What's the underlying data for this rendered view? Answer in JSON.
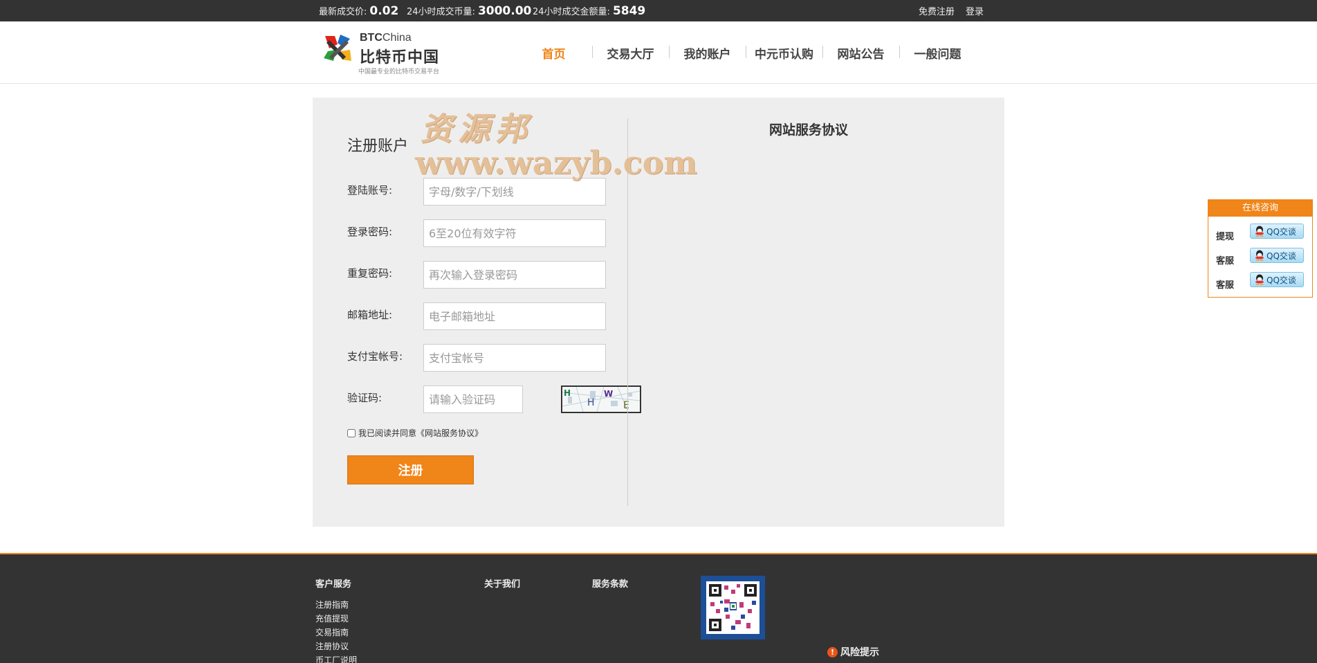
{
  "topbar": {
    "last_price_label": "最新成交价:",
    "last_price_value": "0.02",
    "volume_label": "24小时成交币量:",
    "volume_value": "3000.00",
    "amount_label": "24小时成交金额量:",
    "amount_value": "5849",
    "register_link": "免费注册",
    "login_link": "登录"
  },
  "logo": {
    "brand_en_bold": "BTC",
    "brand_en_light": "China",
    "brand_cn": "比特币中国",
    "slogan": "中国最专业的比特币交易平台",
    "icon": "btc-china-logo-icon"
  },
  "nav": {
    "items": [
      {
        "label": "首页",
        "active": true
      },
      {
        "label": "交易大厅"
      },
      {
        "label": "我的账户"
      },
      {
        "label": "中元币认购"
      },
      {
        "label": "网站公告"
      },
      {
        "label": "一般问题"
      }
    ]
  },
  "form": {
    "title": "注册账户",
    "fields": [
      {
        "label": "登陆账号:",
        "placeholder": "字母/数字/下划线",
        "value": ""
      },
      {
        "label": "登录密码:",
        "placeholder": "6至20位有效字符",
        "value": ""
      },
      {
        "label": "重复密码:",
        "placeholder": "再次输入登录密码",
        "value": ""
      },
      {
        "label": "邮箱地址:",
        "placeholder": "电子邮箱地址",
        "value": ""
      },
      {
        "label": "支付宝帐号:",
        "placeholder": "支付宝帐号",
        "value": ""
      },
      {
        "label": "验证码:",
        "placeholder": "请输入验证码",
        "value": ""
      }
    ],
    "captcha_text": "HHWE",
    "agree_text": "我已阅读并同意《网站服务协议》",
    "agree_checked": false,
    "submit_label": "注册"
  },
  "agreement": {
    "title": "网站服务协议"
  },
  "watermark": {
    "cn": "资源邦",
    "url": "www.wazyb.com"
  },
  "consult": {
    "title": "在线咨询",
    "rows": [
      {
        "label": "提现",
        "button": "QQ交谈"
      },
      {
        "label": "客服",
        "button": "QQ交谈"
      },
      {
        "label": "客服",
        "button": "QQ交谈"
      }
    ]
  },
  "footer": {
    "columns": [
      {
        "title": "客户服务",
        "links": [
          "注册指南",
          "充值提现",
          "交易指南",
          "注册协议",
          "币工厂说明"
        ]
      },
      {
        "title": "关于我们",
        "links": []
      },
      {
        "title": "服务条款",
        "links": []
      }
    ],
    "risk_label": "风险提示"
  },
  "colors": {
    "accent": "#f08519",
    "topbar_bg": "#333333",
    "panel_bg": "#eeeeee",
    "footer_bg": "#333333"
  }
}
